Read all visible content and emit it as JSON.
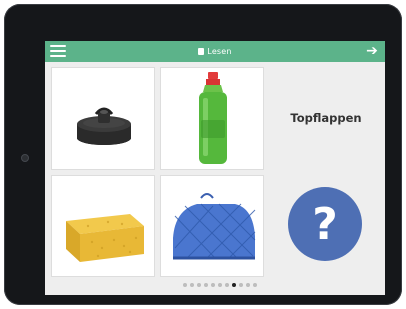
{
  "header": {
    "title": "Lesen",
    "menu_icon": "hamburger-menu-icon",
    "next_icon": "arrow-right-icon",
    "next_symbol": "➔",
    "bar_color": "#5cb38a"
  },
  "cards": [
    {
      "name": "drain-plug-image"
    },
    {
      "name": "dish-soap-bottle-image"
    },
    {
      "name": "sponge-image"
    },
    {
      "name": "pot-holder-image"
    }
  ],
  "target_word": "Topflappen",
  "audio_button": {
    "symbol": "?",
    "color": "#4e6fb4"
  },
  "pagination": {
    "total": 11,
    "current": 8
  }
}
